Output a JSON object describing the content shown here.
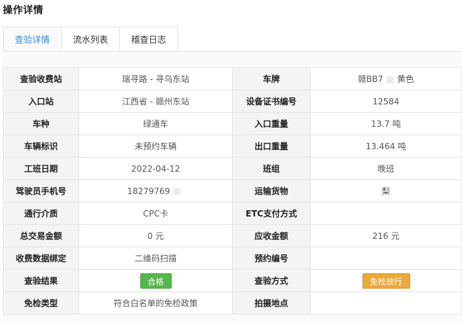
{
  "page": {
    "title": "操作详情"
  },
  "tabs": [
    {
      "label": "查验详情",
      "active": true
    },
    {
      "label": "流水列表",
      "active": false
    },
    {
      "label": "稽查日志",
      "active": false
    }
  ],
  "rows": [
    {
      "l1": "查验收费站",
      "v1": "瑞寻路 - 寻乌东站",
      "l2": "车牌",
      "v2": "赣BB7",
      "v2_tail": "黄色"
    },
    {
      "l1": "入口站",
      "v1": "江西省 - 赣州东站",
      "l2": "设备证书编号",
      "v2": "12584"
    },
    {
      "l1": "车种",
      "v1": "绿通车",
      "l2": "入口重量",
      "v2": "13.7 吨"
    },
    {
      "l1": "车辆标识",
      "v1": "未预约车辆",
      "l2": "出口重量",
      "v2": "13.464 吨"
    },
    {
      "l1": "工班日期",
      "v1": "2022-04-12",
      "l2": "班组",
      "v2": "晚班"
    },
    {
      "l1": "驾驶员手机号",
      "v1": "18279769",
      "l2": "运输货物",
      "v2": "梨"
    },
    {
      "l1": "通行介质",
      "v1": "CPC卡",
      "l2": "ETC支付方式",
      "v2": ""
    },
    {
      "l1": "总交易金额",
      "v1": "0 元",
      "l2": "应收金额",
      "v2": "216 元"
    },
    {
      "l1": "收费数据绑定",
      "v1": "二维码扫描",
      "l2": "预约编号",
      "v2": ""
    },
    {
      "l1": "查验结果",
      "v1": "合格",
      "l2": "查验方式",
      "v2": "免检放行"
    },
    {
      "l1": "免检类型",
      "v1": "符合白名单的免检政策",
      "l2": "拍摄地点",
      "v2": ""
    }
  ],
  "colors": {
    "accent": "#2f8fd8",
    "success": "#56b74d",
    "warning": "#eba93a",
    "green_text": "#4bb04a"
  }
}
